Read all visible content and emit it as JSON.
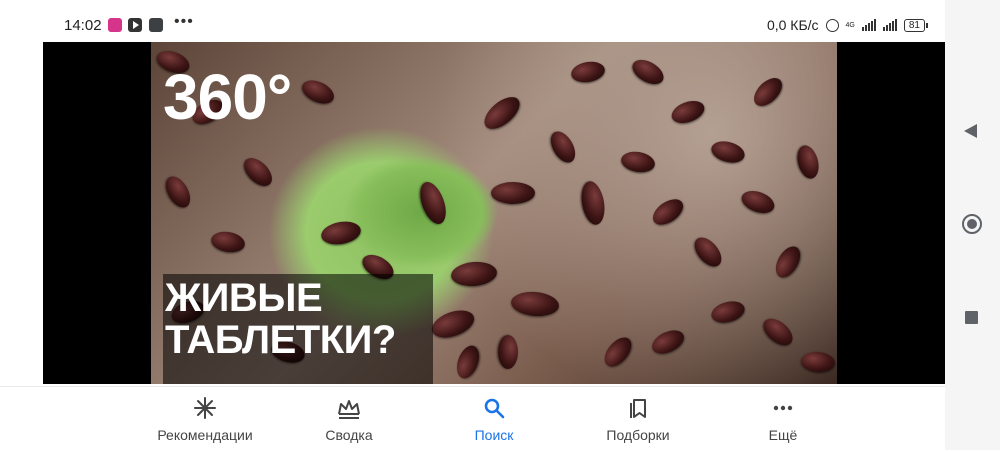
{
  "status_bar": {
    "time": "14:02",
    "more": "•••",
    "net_speed": "0,0 КБ/с",
    "battery": "81",
    "network_label": "4G"
  },
  "media": {
    "badge": "360°",
    "headline_line1": "ЖИВЫЕ",
    "headline_line2": "ТАБЛЕТКИ?"
  },
  "bottom_nav": {
    "items": [
      {
        "label": "Рекомендации",
        "icon": "sparkle-icon"
      },
      {
        "label": "Сводка",
        "icon": "digest-icon"
      },
      {
        "label": "Поиск",
        "icon": "search-icon",
        "active": true
      },
      {
        "label": "Подборки",
        "icon": "bookmarks-icon"
      },
      {
        "label": "Ещё",
        "icon": "more-icon"
      }
    ]
  },
  "colors": {
    "accent": "#1a73e8",
    "nav_text": "#444444"
  }
}
